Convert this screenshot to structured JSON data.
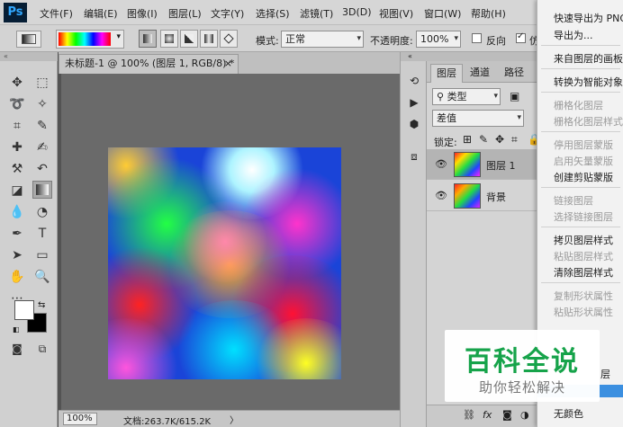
{
  "app": {
    "logo": "Ps"
  },
  "menubar": {
    "items": [
      "文件(F)",
      "编辑(E)",
      "图像(I)",
      "图层(L)",
      "文字(Y)",
      "选择(S)",
      "滤镜(T)",
      "3D(D)",
      "视图(V)",
      "窗口(W)",
      "帮助(H)"
    ]
  },
  "options": {
    "mode_label": "模式:",
    "mode_value": "正常",
    "opacity_label": "不透明度:",
    "opacity_value": "100%",
    "reverse_label": "反向",
    "dither_label": "仿"
  },
  "document": {
    "tab_title": "未标题-1 @ 100% (图层 1, RGB/8) *",
    "tab_close": "×",
    "zoom": "100%",
    "doc_info": "文档:263.7K/615.2K",
    "status_arrow": "〉"
  },
  "layers_panel": {
    "tabs": [
      "图层",
      "通道",
      "路径"
    ],
    "filter_label": "类型",
    "blend_mode": "差值",
    "lock_label": "锁定:",
    "layers": [
      {
        "name": "图层 1",
        "selected": true
      },
      {
        "name": "背景",
        "selected": false
      }
    ],
    "footer_fx": "fx"
  },
  "context_menu": {
    "items": [
      {
        "label": "快速导出为 PNG",
        "disabled": false
      },
      {
        "label": "导出为...",
        "disabled": false
      },
      {
        "label": "来自图层的画板...",
        "disabled": false
      },
      {
        "label": "转换为智能对象",
        "disabled": false
      },
      {
        "label": "栅格化图层",
        "disabled": true
      },
      {
        "label": "栅格化图层样式",
        "disabled": true
      },
      {
        "label": "停用图层蒙版",
        "disabled": true
      },
      {
        "label": "启用矢量蒙版",
        "disabled": true
      },
      {
        "label": "创建剪贴蒙版",
        "disabled": false
      },
      {
        "label": "链接图层",
        "disabled": true
      },
      {
        "label": "选择链接图层",
        "disabled": true
      },
      {
        "label": "拷贝图层样式",
        "disabled": false
      },
      {
        "label": "粘贴图层样式",
        "disabled": true
      },
      {
        "label": "清除图层样式",
        "disabled": false
      },
      {
        "label": "复制形状属性",
        "disabled": true
      },
      {
        "label": "粘贴形状属性",
        "disabled": true
      },
      {
        "label": "层",
        "disabled": false
      },
      {
        "label": "无颜色",
        "disabled": false
      }
    ]
  },
  "watermark": {
    "title": "百科全说",
    "subtitle": "助你轻松解决"
  }
}
